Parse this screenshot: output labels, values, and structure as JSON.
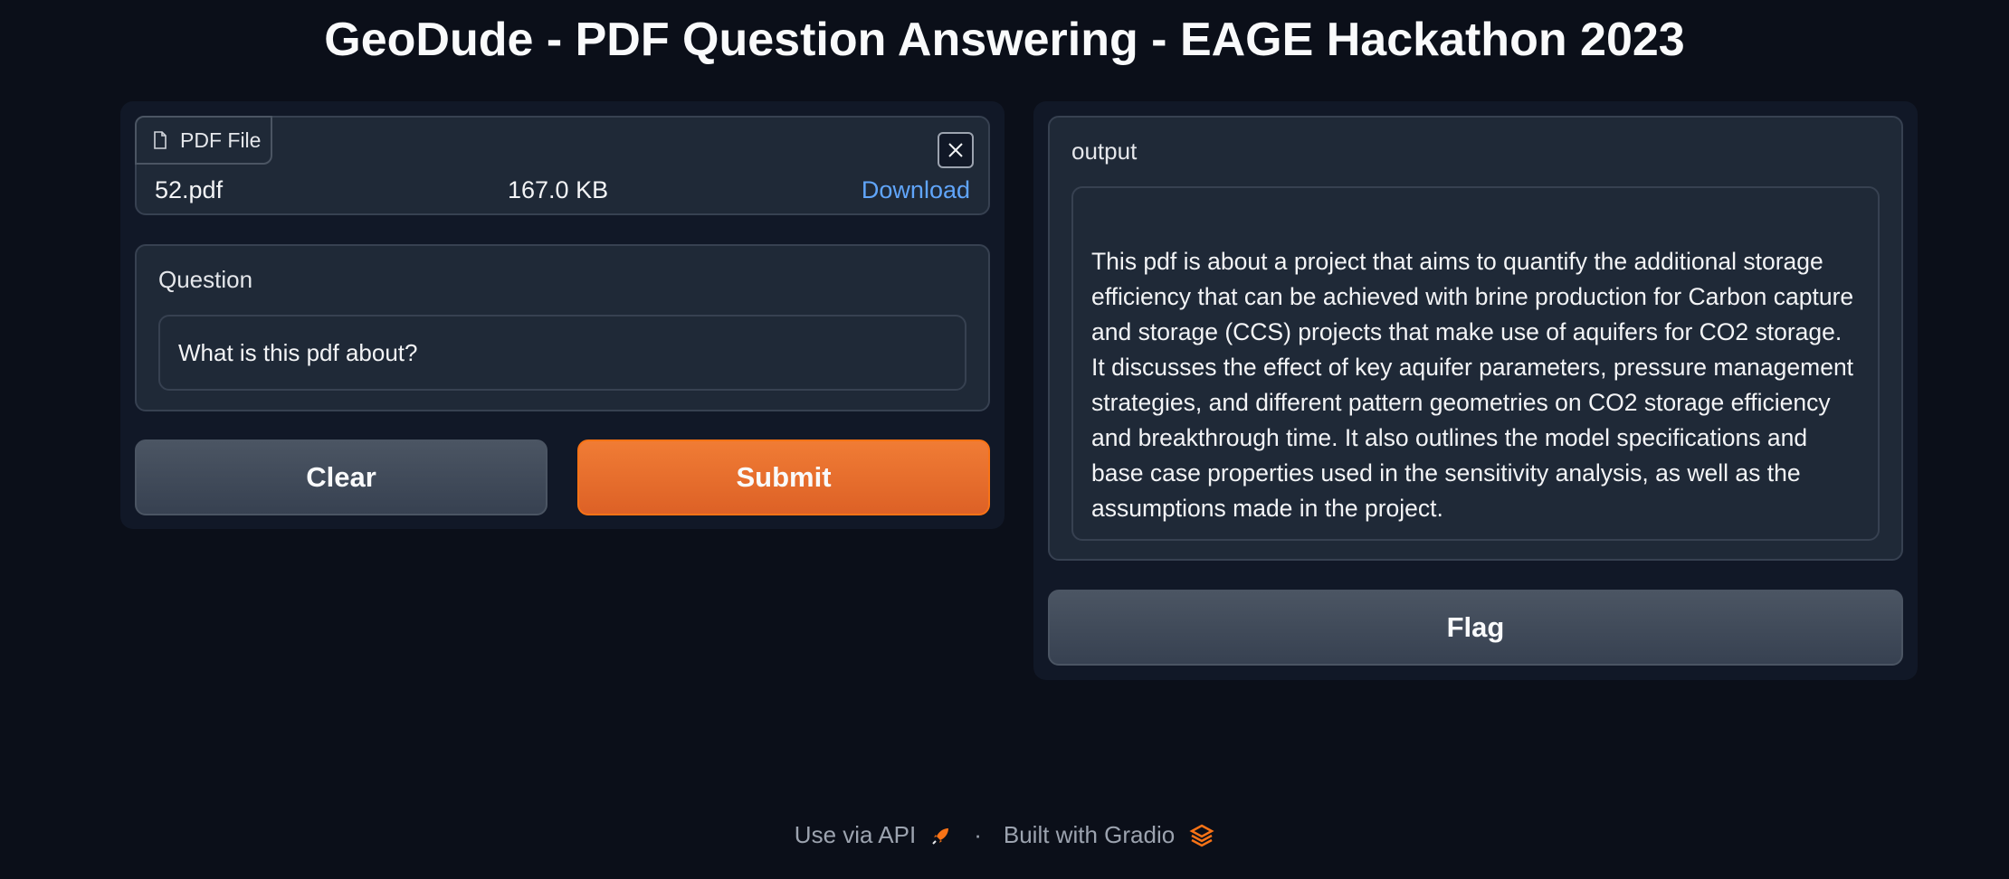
{
  "app": {
    "title": "GeoDude - PDF Question Answering - EAGE Hackathon 2023"
  },
  "file": {
    "label": "PDF File",
    "name": "52.pdf",
    "size": "167.0 KB",
    "download": "Download",
    "icons": {
      "file": "file-icon",
      "close": "close-icon"
    }
  },
  "question": {
    "label": "Question",
    "value": "What is this pdf about?"
  },
  "buttons": {
    "clear": "Clear",
    "submit": "Submit",
    "flag": "Flag"
  },
  "output": {
    "label": "output",
    "text": "This pdf is about a project that aims to quantify the additional storage efficiency that can be achieved with brine production for Carbon capture and storage (CCS) projects that make use of aquifers for CO2 storage. It discusses the effect of key aquifer parameters, pressure management strategies, and different pattern geometries on CO2 storage efficiency and breakthrough time. It also outlines the model specifications and base case properties used in the sensitivity analysis, as well as the assumptions made in the project."
  },
  "footer": {
    "api": "Use via API",
    "separator": "·",
    "built": "Built with Gradio",
    "icons": {
      "api": "rocket-icon",
      "gradio": "gradio-logo-icon"
    }
  },
  "colors": {
    "background": "#0b0f19",
    "panel": "#111827",
    "block": "#1f2937",
    "accent": "#f97316",
    "link": "#60a5fa"
  }
}
